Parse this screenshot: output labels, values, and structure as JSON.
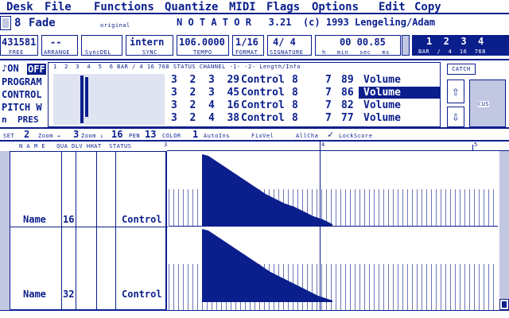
{
  "menu": [
    "Desk",
    "File",
    "Functions",
    "Quantize",
    "MIDI",
    "Flags",
    "Options",
    "Edit",
    "Copy"
  ],
  "window": {
    "number": "8",
    "name": "Fade",
    "original": "original",
    "title": "N O T A T O R   3.21  (c) 1993 Lengeling/Adam"
  },
  "status_fields": [
    {
      "value": "431581",
      "label": "FREE"
    },
    {
      "value": "--",
      "label": "ARRANGE"
    },
    {
      "value": "",
      "label": "SyncDEL"
    },
    {
      "value": "intern",
      "label": "SYNC"
    },
    {
      "value": "106.0000",
      "label": "TEMPO"
    },
    {
      "value": "1/16",
      "label": "FORMAT"
    },
    {
      "value": "4/ 4",
      "label": "SIGNATURE"
    }
  ],
  "time": {
    "value": "00 00.85",
    "labels": "h   min   sec   ms"
  },
  "bar": {
    "value": "1  2  3  4",
    "label": "BAR  /  4  16  768"
  },
  "left_buttons": [
    "ON",
    "OFF",
    "PROGRAM",
    "CONTROL",
    "PITCH W",
    "n",
    "PRES"
  ],
  "event_header": {
    "ruler": "1  2  3  4  5  6 BAR / 4 16 768 STATUS CHANNEL -1- -2- Length/Info"
  },
  "events": [
    {
      "pos": "3  2  3  29",
      "status": "Control",
      "channel": "8",
      "v1": "7",
      "v2": "89",
      "info": "Volume",
      "selected": false
    },
    {
      "pos": "3  2  3  45",
      "status": "Control",
      "channel": "8",
      "v1": "7",
      "v2": "86",
      "info": "Volume",
      "selected": true
    },
    {
      "pos": "3  2  4  16",
      "status": "Control",
      "channel": "8",
      "v1": "7",
      "v2": "82",
      "info": "Volume",
      "selected": false
    },
    {
      "pos": "3  2  4  38",
      "status": "Control",
      "channel": "8",
      "v1": "7",
      "v2": "77",
      "info": "Volume",
      "selected": false
    }
  ],
  "right_panel": {
    "catch": "CATCH",
    "up": "⇧",
    "down": "⇩",
    "cus": "CUS"
  },
  "toolbar": {
    "set": "SET",
    "set_val": "2",
    "zoom_h": "Zoom →",
    "zoom_h_val": "3",
    "zoom_v": "Zoom ↓",
    "zoom_v_val": "16",
    "pen": "PEN",
    "pen_val": "13",
    "color": "COLOR",
    "color_val": "1",
    "autoins": "AutoIns",
    "fixvel": "FixVel",
    "allcha": "AllCha",
    "check": "✓",
    "lockscore": "LockScore"
  },
  "track_header": {
    "cols": "N A M E   QUA DLV HHAT  STATUS",
    "ruler_marks": [
      "3",
      "4",
      "5"
    ]
  },
  "tracks": [
    {
      "name": "Name",
      "qua": "16",
      "status": "Control"
    },
    {
      "name": "Name",
      "qua": "32",
      "status": "Control"
    }
  ]
}
